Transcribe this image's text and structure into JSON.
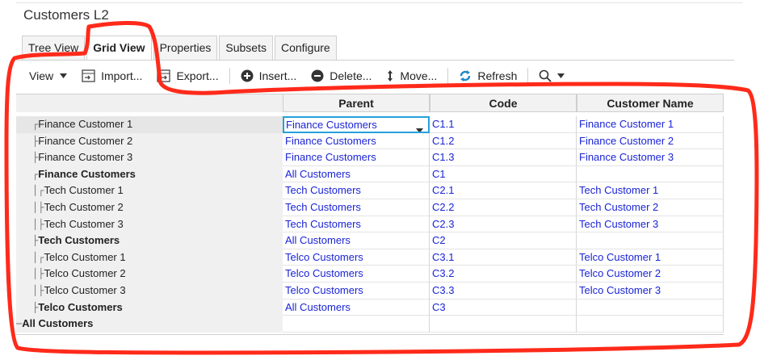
{
  "window": {
    "title": "Customers L2"
  },
  "tabs": [
    {
      "label": "Tree View",
      "active": false
    },
    {
      "label": "Grid View",
      "active": true
    },
    {
      "label": "Properties",
      "active": false
    },
    {
      "label": "Subsets",
      "active": false
    },
    {
      "label": "Configure",
      "active": false
    }
  ],
  "toolbar": {
    "view": "View",
    "import": "Import...",
    "export": "Export...",
    "insert": "Insert...",
    "delete": "Delete...",
    "move": "Move...",
    "refresh": "Refresh"
  },
  "grid": {
    "columns": [
      "Parent",
      "Code",
      "Customer Name"
    ],
    "rows": [
      {
        "label": "Finance Customer 1",
        "bold": false,
        "indent": 2,
        "glyph": "┌",
        "parent": "Finance Customers",
        "code": "C1.1",
        "name": "Finance Customer 1",
        "selected": true
      },
      {
        "label": "Finance Customer 2",
        "bold": false,
        "indent": 2,
        "glyph": "├",
        "parent": "Finance Customers",
        "code": "C1.2",
        "name": "Finance Customer 2",
        "selected": false
      },
      {
        "label": "Finance Customer 3",
        "bold": false,
        "indent": 2,
        "glyph": "├",
        "parent": "Finance Customers",
        "code": "C1.3",
        "name": "Finance Customer 3",
        "selected": false
      },
      {
        "label": "Finance Customers",
        "bold": true,
        "indent": 1,
        "glyph": "┌",
        "parent": "All Customers",
        "code": "C1",
        "name": "",
        "selected": false
      },
      {
        "label": "Tech Customer 1",
        "bold": false,
        "indent": 2,
        "glyph": "│┌",
        "parent": "Tech Customers",
        "code": "C2.1",
        "name": "Tech Customer 1",
        "selected": false
      },
      {
        "label": "Tech Customer 2",
        "bold": false,
        "indent": 2,
        "glyph": "│├",
        "parent": "Tech Customers",
        "code": "C2.2",
        "name": "Tech Customer 2",
        "selected": false
      },
      {
        "label": "Tech Customer 3",
        "bold": false,
        "indent": 2,
        "glyph": "│├",
        "parent": "Tech Customers",
        "code": "C2.3",
        "name": "Tech Customer 3",
        "selected": false
      },
      {
        "label": "Tech Customers",
        "bold": true,
        "indent": 1,
        "glyph": "├",
        "parent": "All Customers",
        "code": "C2",
        "name": "",
        "selected": false
      },
      {
        "label": "Telco Customer 1",
        "bold": false,
        "indent": 2,
        "glyph": "│┌",
        "parent": "Telco Customers",
        "code": "C3.1",
        "name": "Telco Customer 1",
        "selected": false
      },
      {
        "label": "Telco Customer 2",
        "bold": false,
        "indent": 2,
        "glyph": "│├",
        "parent": "Telco Customers",
        "code": "C3.2",
        "name": "Telco Customer 2",
        "selected": false
      },
      {
        "label": "Telco Customer 3",
        "bold": false,
        "indent": 2,
        "glyph": "│├",
        "parent": "Telco Customers",
        "code": "C3.3",
        "name": "Telco Customer 3",
        "selected": false
      },
      {
        "label": "Telco Customers",
        "bold": true,
        "indent": 1,
        "glyph": "├",
        "parent": "All Customers",
        "code": "C3",
        "name": "",
        "selected": false
      },
      {
        "label": "All Customers",
        "bold": true,
        "indent": 0,
        "glyph": "─",
        "parent": "",
        "code": "",
        "name": "",
        "selected": false
      }
    ]
  },
  "colors": {
    "link": "#1a24d6",
    "selection": "#27a0db",
    "annotation": "#ff2a1a"
  }
}
